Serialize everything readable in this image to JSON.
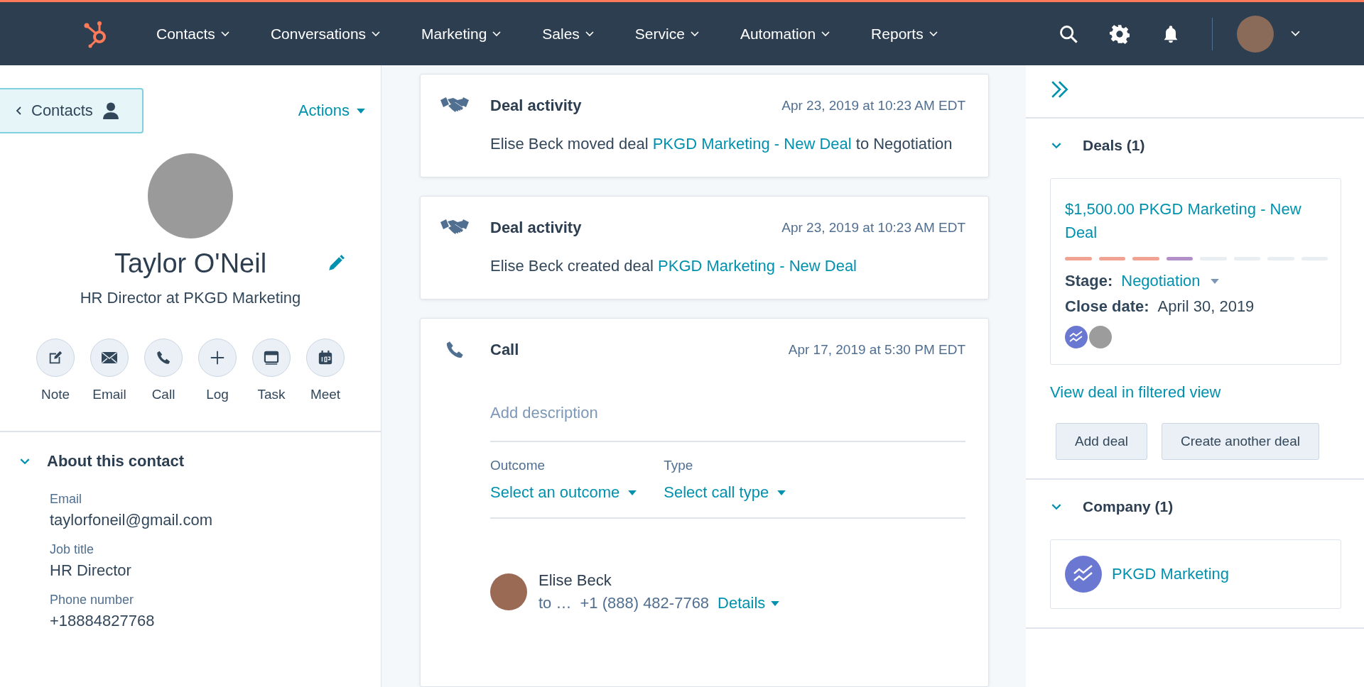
{
  "nav": {
    "items": [
      {
        "label": "Contacts"
      },
      {
        "label": "Conversations"
      },
      {
        "label": "Marketing"
      },
      {
        "label": "Sales"
      },
      {
        "label": "Service"
      },
      {
        "label": "Automation"
      },
      {
        "label": "Reports"
      }
    ]
  },
  "contact": {
    "back_label": "Contacts",
    "actions_label": "Actions",
    "name": "Taylor O'Neil",
    "subtitle": "HR Director at PKGD Marketing",
    "quick_actions": [
      {
        "kind": "note",
        "label": "Note"
      },
      {
        "kind": "email",
        "label": "Email"
      },
      {
        "kind": "call",
        "label": "Call"
      },
      {
        "kind": "log",
        "label": "Log"
      },
      {
        "kind": "task",
        "label": "Task"
      },
      {
        "kind": "meet",
        "label": "Meet"
      }
    ],
    "about": {
      "title": "About this contact",
      "expanded": true,
      "fields": [
        {
          "label": "Email",
          "value": "taylorfoneil@gmail.com"
        },
        {
          "label": "Job title",
          "value": "HR Director"
        },
        {
          "label": "Phone number",
          "value": "+18884827768"
        }
      ]
    }
  },
  "timeline": [
    {
      "kind": "deal",
      "title": "Deal activity",
      "date": "Apr 23, 2019 at 10:23 AM EDT",
      "text_before": "Elise Beck moved deal ",
      "link": "PKGD Marketing - New Deal",
      "text_after": " to Negotiation"
    },
    {
      "kind": "deal",
      "title": "Deal activity",
      "date": "Apr 23, 2019 at 10:23 AM EDT",
      "text_before": "Elise Beck created deal ",
      "link": "PKGD Marketing - New Deal"
    },
    {
      "kind": "call",
      "title": "Call",
      "date": "Apr 17, 2019 at 5:30 PM EDT",
      "description_placeholder": "Add description",
      "outcome_label": "Outcome",
      "outcome_value": "Select an outcome",
      "type_label": "Type",
      "type_value": "Select call type",
      "caller": "Elise Beck",
      "to_prefix": "to …",
      "phone": "+1 (888) 482-7768",
      "details": "Details"
    }
  ],
  "sidebar": {
    "deals": {
      "title": "Deals (1)",
      "expanded": true,
      "deal_name": "$1,500.00 PKGD Marketing - New Deal",
      "stages": [
        {
          "color": "#f2a293"
        },
        {
          "color": "#f2a293"
        },
        {
          "color": "#f2a293"
        },
        {
          "color": "#b38fc9"
        },
        {
          "color": "#e9eef3"
        },
        {
          "color": "#e9eef3"
        },
        {
          "color": "#e9eef3"
        },
        {
          "color": "#e9eef3"
        }
      ],
      "stage_label": "Stage:",
      "stage_value": "Negotiation",
      "close_label": "Close date:",
      "close_value": "April 30, 2019",
      "view_link": "View deal in filtered view",
      "buttons": [
        "Add deal",
        "Create another deal"
      ]
    },
    "company": {
      "title": "Company (1)",
      "expanded": true,
      "name": "PKGD Marketing"
    }
  }
}
